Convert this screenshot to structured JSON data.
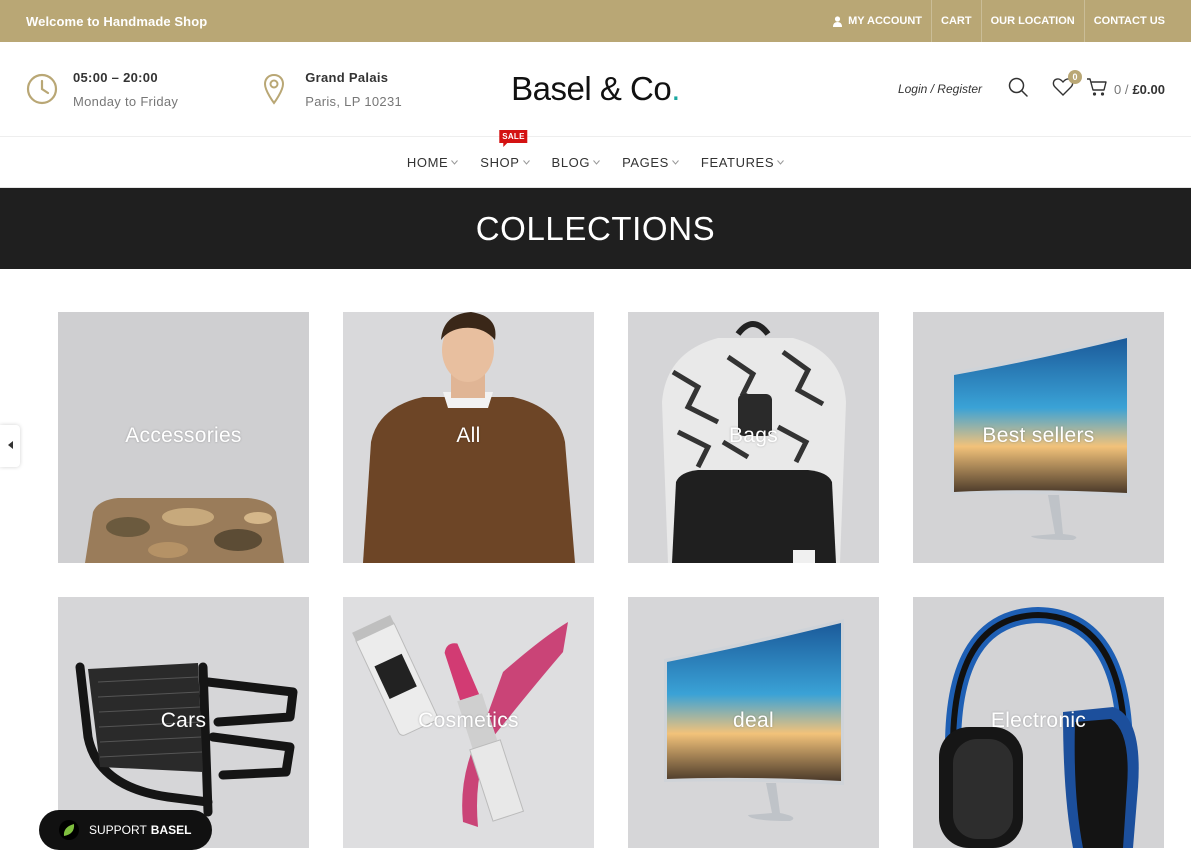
{
  "topbar": {
    "welcome": "Welcome to Handmade Shop",
    "links": [
      "MY ACCOUNT",
      "CART",
      "OUR LOCATION",
      "CONTACT US"
    ]
  },
  "header": {
    "hours": "05:00 – 20:00",
    "days": "Monday to Friday",
    "location_name": "Grand Palais",
    "location_addr": "Paris, LP 10231",
    "logo_text": "Basel & Co",
    "logo_dot": ".",
    "login": "Login / Register",
    "wishlist_count": "0",
    "cart_count": "0 /",
    "cart_total": "£0.00"
  },
  "nav": {
    "items": [
      "HOME",
      "SHOP",
      "BLOG",
      "PAGES",
      "FEATURES"
    ],
    "sale_tag": "SALE"
  },
  "page_title": "COLLECTIONS",
  "collections": [
    {
      "label": "Accessories"
    },
    {
      "label": "All"
    },
    {
      "label": "Bags"
    },
    {
      "label": "Best sellers"
    },
    {
      "label": "Cars"
    },
    {
      "label": "Cosmetics"
    },
    {
      "label": "deal"
    },
    {
      "label": "Electronic"
    }
  ],
  "support": {
    "prefix": "SUPPORT",
    "brand": "BASEL"
  },
  "colors": {
    "topbar": "#b9a775",
    "title_band": "#1f1f1f",
    "logo_dot": "#1aa7a0",
    "sale": "#d41212"
  },
  "icons": [
    "user-icon",
    "clock-icon",
    "map-pin-icon",
    "search-icon",
    "heart-icon",
    "cart-icon",
    "chevron-down-icon",
    "chevron-left-icon",
    "leaf-icon"
  ]
}
